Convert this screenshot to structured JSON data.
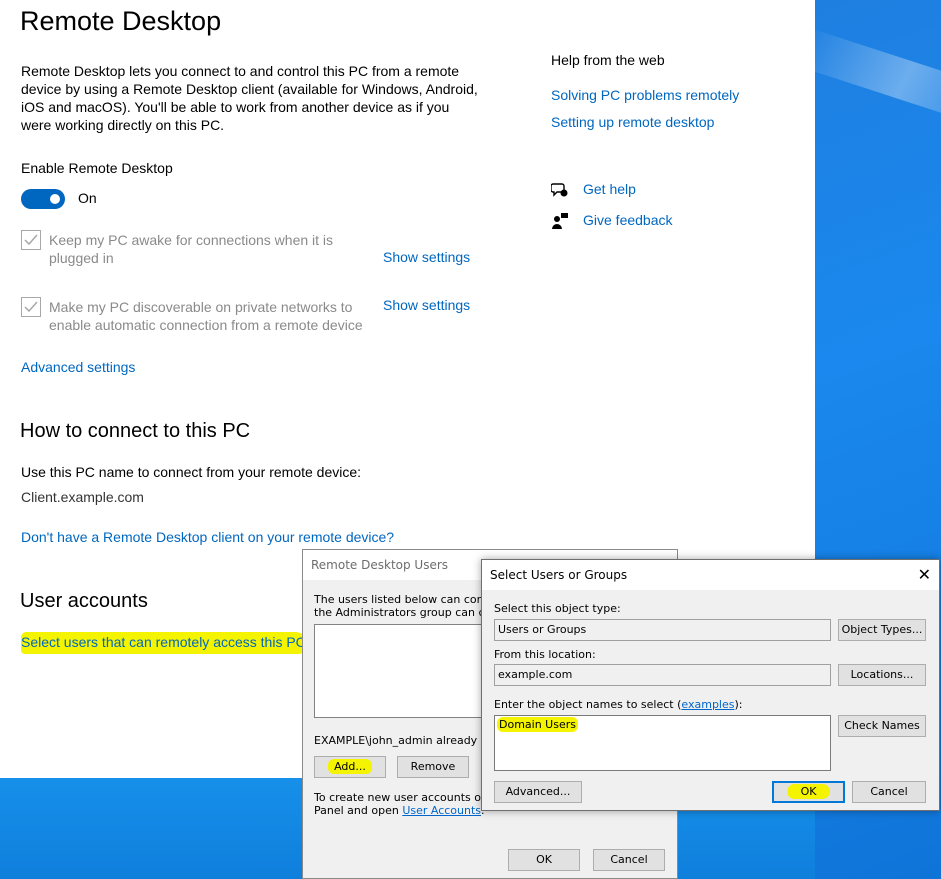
{
  "settings": {
    "title": "Remote Desktop",
    "intro": "Remote Desktop lets you connect to and control this PC from a remote device by using a Remote Desktop client (available for Windows, Android, iOS and macOS). You'll be able to work from another device as if you were working directly on this PC.",
    "enable_label": "Enable Remote Desktop",
    "toggle_state": "On",
    "checkbox_awake_line1": "Keep my PC awake for connections when it is",
    "checkbox_awake_line2": "plugged in",
    "checkbox_discover_line1": "Make my PC discoverable on private networks to",
    "checkbox_discover_line2": "enable automatic connection from a remote device",
    "show_settings_1": "Show settings",
    "show_settings_2": "Show settings",
    "advanced_settings": "Advanced settings",
    "how_to_heading": "How to connect to this PC",
    "pc_name_prompt": "Use this PC name to connect from your remote device:",
    "pc_name": "Client.example.com",
    "no_client_link": "Don't have a Remote Desktop client on your remote device?",
    "user_accounts_heading": "User accounts",
    "select_users_link": "Select users that can remotely access this PC"
  },
  "help": {
    "title": "Help from the web",
    "link_1": "Solving PC problems remotely",
    "link_2": "Setting up remote desktop",
    "get_help": "Get help",
    "give_feedback": "Give feedback"
  },
  "rdu_dialog": {
    "title": "Remote Desktop Users",
    "desc_line1": "The users listed below can connect",
    "desc_line2": "the Administrators group can connec",
    "already_has": "EXAMPLE\\john_admin already has",
    "add": "Add...",
    "remove": "Remove",
    "create_line1": "To create new user accounts or add",
    "create_line2_prefix": "Panel and open ",
    "user_accounts_link": "User Accounts",
    "create_line2_suffix": ".",
    "ok": "OK",
    "cancel": "Cancel"
  },
  "select_dialog": {
    "title": "Select Users or Groups",
    "close": "✕",
    "object_type_label": "Select this object type:",
    "object_type_value": "Users or Groups",
    "object_types_button": "Object Types...",
    "location_label": "From this location:",
    "location_value": "example.com",
    "locations_button": "Locations...",
    "names_label_prefix": "Enter the object names to select (",
    "examples_link": "examples",
    "names_label_suffix": "):",
    "names_value": "Domain Users",
    "check_names_button": "Check Names",
    "advanced_button": "Advanced...",
    "ok": "OK",
    "cancel": "Cancel"
  },
  "colors": {
    "accent": "#0067c0",
    "highlight": "#f4f400",
    "desktop": "#1a88ee"
  }
}
